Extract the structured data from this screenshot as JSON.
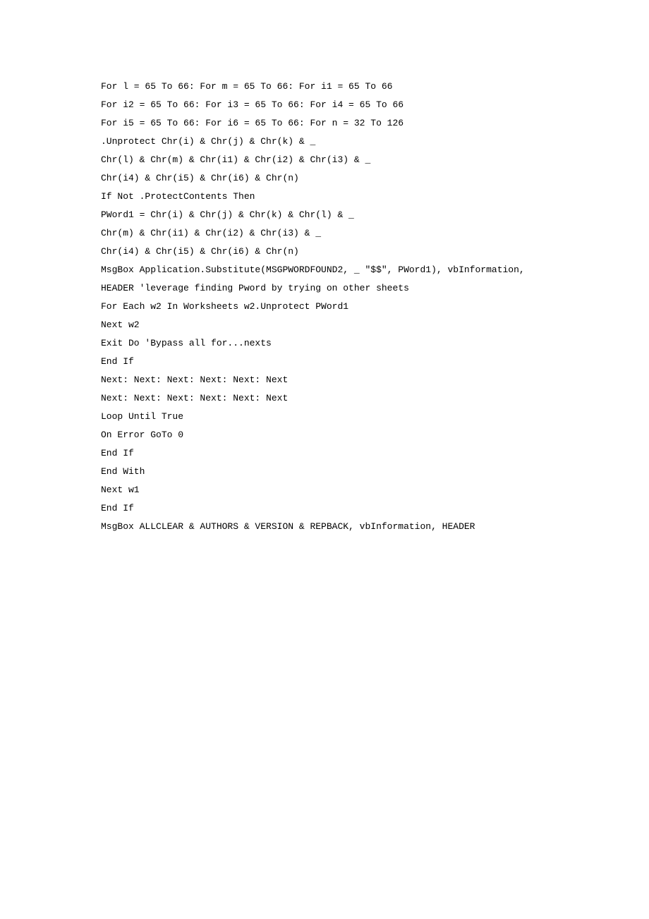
{
  "lines": [
    "For l = 65 To 66: For m = 65 To 66: For i1 = 65 To 66",
    "For i2 = 65 To 66: For i3 = 65 To 66: For i4 = 65 To 66",
    "For i5 = 65 To 66: For i6 = 65 To 66: For n = 32 To 126",
    ".Unprotect Chr(i) & Chr(j) & Chr(k) & _",
    "Chr(l) & Chr(m) & Chr(i1) & Chr(i2) & Chr(i3) & _",
    "Chr(i4) & Chr(i5) & Chr(i6) & Chr(n)",
    "If Not .ProtectContents Then",
    "PWord1 = Chr(i) & Chr(j) & Chr(k) & Chr(l) & _",
    "Chr(m) & Chr(i1) & Chr(i2) & Chr(i3) & _",
    "Chr(i4) & Chr(i5) & Chr(i6) & Chr(n)",
    "MsgBox Application.Substitute(MSGPWORDFOUND2, _ \"$$\", PWord1), vbInformation, HEADER 'leverage finding Pword by trying on other sheets",
    "For Each w2 In Worksheets w2.Unprotect PWord1",
    "Next w2",
    "Exit Do 'Bypass all for...nexts",
    "End If",
    "Next: Next: Next: Next: Next: Next",
    "Next: Next: Next: Next: Next: Next",
    "Loop Until True",
    "On Error GoTo 0",
    "End If",
    "End With",
    "Next w1",
    "End If",
    "MsgBox ALLCLEAR & AUTHORS & VERSION & REPBACK, vbInformation, HEADER"
  ]
}
